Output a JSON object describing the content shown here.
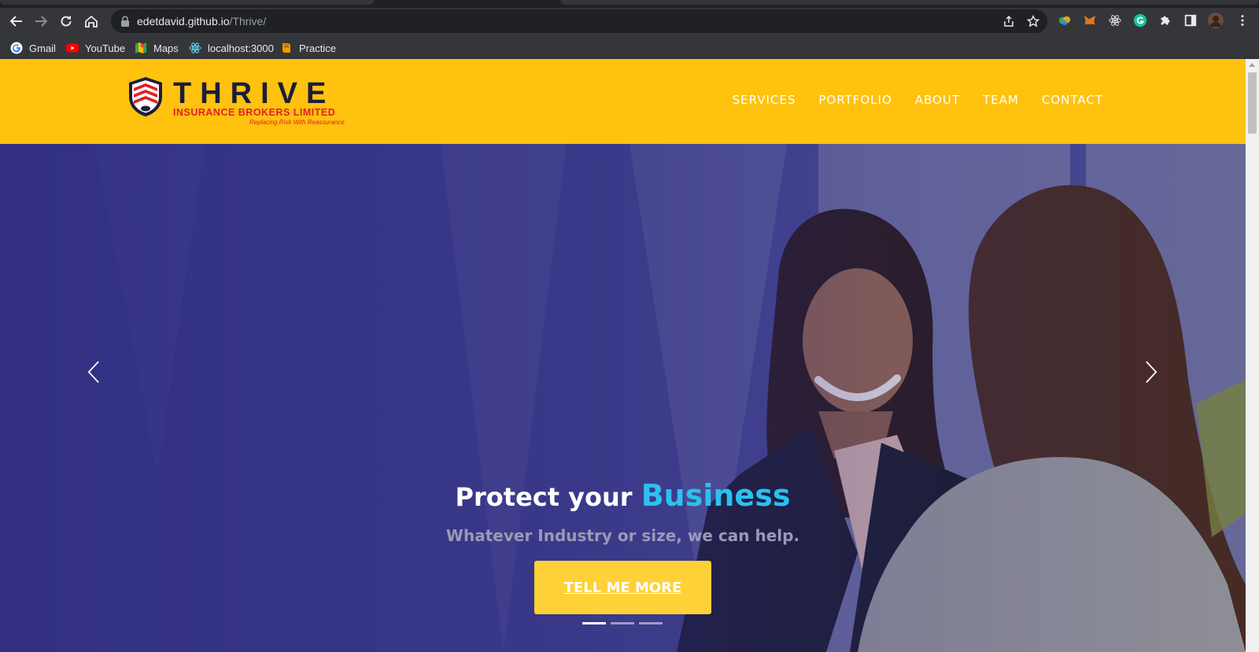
{
  "browser": {
    "url_host": "edetdavid.github.io",
    "url_path": "/Thrive/",
    "bookmarks": [
      {
        "label": "Gmail",
        "icon": "google-icon"
      },
      {
        "label": "YouTube",
        "icon": "youtube-icon"
      },
      {
        "label": "Maps",
        "icon": "maps-icon"
      },
      {
        "label": "localhost:3000",
        "icon": "react-icon"
      },
      {
        "label": "Practice",
        "icon": "book-icon"
      }
    ]
  },
  "site": {
    "logo": {
      "wordmark": "THRIVE",
      "subtitle": "INSURANCE BROKERS LIMITED",
      "tagline": "Replacing Risk With Reassurance"
    },
    "nav": [
      "SERVICES",
      "PORTFOLIO",
      "ABOUT",
      "TEAM",
      "CONTACT"
    ],
    "hero": {
      "title_prefix": "Protect your",
      "title_accent": "Business",
      "subtitle": "Whatever Industry or size, we can help.",
      "cta_label": "TELL ME MORE",
      "slide_count": 3,
      "active_slide": 1
    }
  },
  "colors": {
    "header_bg": "#fec20f",
    "accent_blue": "#2bc1ef",
    "cta_bg": "#fed136",
    "overlay": "#2c287d"
  }
}
